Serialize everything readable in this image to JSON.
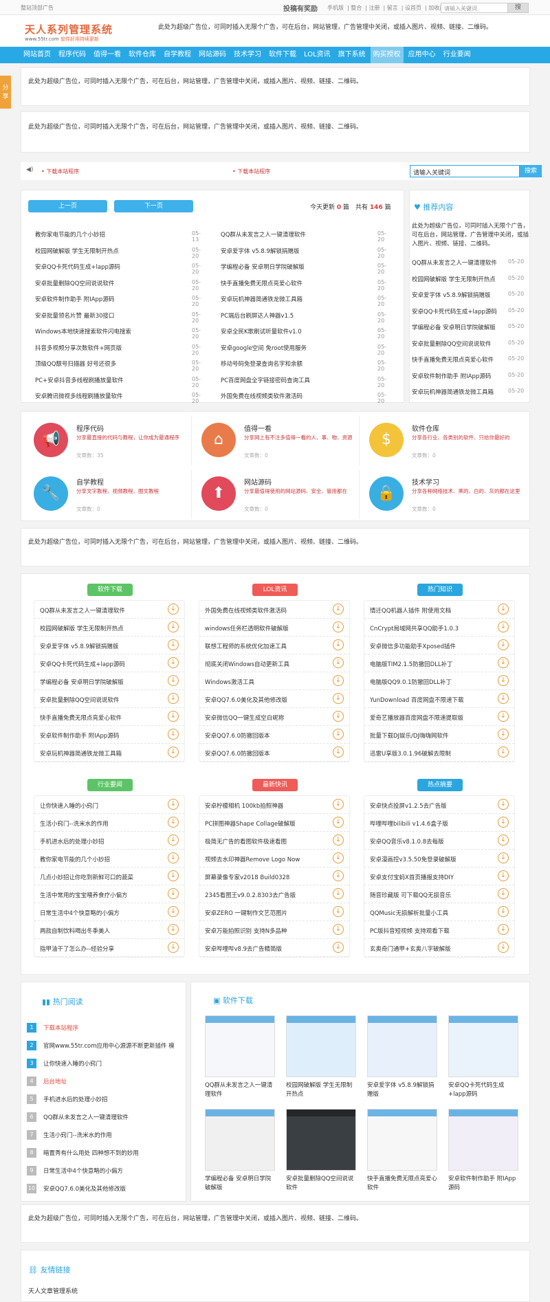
{
  "topbar": {
    "left": "整站顶部广告",
    "contribute": "投稿有奖励",
    "links": [
      "手机版",
      "整合",
      "注册",
      "留言",
      "设首页",
      "加收藏"
    ],
    "search_placeholder": "请输入关键词",
    "search_btn": "搜"
  },
  "header": {
    "logo_title": "天人系列管理系统",
    "logo_url": "www.55tr.com",
    "logo_slogan": "软件好用持续更新",
    "ad": "此处为超级广告位，可同时插入无限个广告，可在后台，网站管理，广告管理中关闭，或插入图片、视频、链接、二维码。"
  },
  "nav": [
    "网站首页",
    "程序代码",
    "值得一看",
    "软件仓库",
    "自学教程",
    "网站源码",
    "技术学习",
    "软件下载",
    "LOL资讯",
    "旗下系统",
    "购买授权",
    "应用中心",
    "行业要闻"
  ],
  "side_tab": "分享",
  "ads": {
    "ad1": "此处为超级广告位，可同时插入无限个广告，可在后台，网站管理，广告管理中关闭，或插入图片、视频、链接、二维码。",
    "ad2": "此处为超级广告位，可同时插入无限个广告，可在后台，网站管理，广告管理中关闭，或插入图片、视频、链接、二维码。",
    "ad3": "此处为超级广告位，可同时插入无限个广告，可在后台，网站管理，广告管理中关闭，或插入图片、视频、链接、二维码。",
    "ad4": "此处为超级广告位，可同时插入无限个广告，可在后台，网站管理，广告管理中关闭，或插入图片、视频、链接、二维码。"
  },
  "notice": {
    "n1": "下载本站程序",
    "n2": "下载本站程序",
    "search_value": "请输入关键词",
    "search_btn": "搜索"
  },
  "latest": {
    "prev": "上一页",
    "next": "下一页",
    "update_prefix": "今天更新",
    "update_count": "0",
    "update_mid": "篇　共有",
    "total_count": "146",
    "update_suffix": "篇",
    "left": [
      {
        "t": "教你家电节能的几个小妙招",
        "d": "05-13"
      },
      {
        "t": "校园网破解版 学生无限制开热点",
        "d": "05-20"
      },
      {
        "t": "安卓QQ卡死代码生成+lapp源码",
        "d": "05-20"
      },
      {
        "t": "安卓批量删除QQ空间说说软件",
        "d": "05-20"
      },
      {
        "t": "安卓软件制作助手 附IApp源码",
        "d": "05-20"
      },
      {
        "t": "安卓批量领名片赞 最新30接口",
        "d": "05-20"
      },
      {
        "t": "Windows本地快速搜索软件闪电搜索",
        "d": "05-20"
      },
      {
        "t": "抖音多视频分享次数软件+网页版",
        "d": "05-20"
      },
      {
        "t": "顶级QQ靓号扫描器 好号还很多",
        "d": "05-20"
      },
      {
        "t": "PC+安卓抖音多线程刷播放量软件",
        "d": "05-20"
      },
      {
        "t": "安卓腾讯微视多线程刷播放量软件",
        "d": "05-20"
      }
    ],
    "right": [
      {
        "t": "QQ群从未发言之人一键清理软件",
        "d": "05-20"
      },
      {
        "t": "安卓爱字体 v5.8.9解锁捐赠版",
        "d": "05-20"
      },
      {
        "t": "学编程必备 安卓明日学院破解版",
        "d": "05-20"
      },
      {
        "t": "快手直播免费无限点亮爱心软件",
        "d": "05-20"
      },
      {
        "t": "安卓玩机神器简通铁龙微工具箱",
        "d": "05-20"
      },
      {
        "t": "PC端后台刷屏达人神器v1.5",
        "d": "05-20"
      },
      {
        "t": "安卓全民K歌刷试听量软件v1.0",
        "d": "05-20"
      },
      {
        "t": "安卓google空间 免root使用服务",
        "d": "05-20"
      },
      {
        "t": "移动号码免登录查询名字和余额",
        "d": "05-20"
      },
      {
        "t": "PC百度网盘全字链接密码查询工具",
        "d": "05-20"
      },
      {
        "t": "外国免费在线视频类软件激活码",
        "d": "05-20"
      }
    ]
  },
  "recommend": {
    "title": "推荐内容",
    "intro": "此处为超级广告位，可同时插入无限个广告，可在后台，网站管理，广告管理中关闭，或插入图片、视频、链接、二维码。",
    "items": [
      {
        "t": "QQ群从未发言之人一键清理软件",
        "d": "05-20"
      },
      {
        "t": "校园网破解版 学生无限制开热点",
        "d": "05-20"
      },
      {
        "t": "安卓爱字体 v5.8.9解锁捐赠版",
        "d": "05-20"
      },
      {
        "t": "安卓QQ卡死代码生成+lapp源码",
        "d": "05-20"
      },
      {
        "t": "学编程必备 安卓明日学院破解版",
        "d": "05-20"
      },
      {
        "t": "安卓批量删除QQ空间说说软件",
        "d": "05-20"
      },
      {
        "t": "快手直播免费无限点亮爱心软件",
        "d": "05-20"
      },
      {
        "t": "安卓软件制作助手 附IApp源码",
        "d": "05-20"
      },
      {
        "t": "安卓玩机神器简通铁龙微工具箱",
        "d": "05-20"
      }
    ]
  },
  "categories": [
    {
      "name": "程序代码",
      "desc": "分享最直接的代码与教程，让你成为最通程序",
      "count": "文章数：35",
      "color": "#e04a5a",
      "icon": "megaphone-icon"
    },
    {
      "name": "值得一看",
      "desc": "分享网上有不注多值得一看的人、事、物、资源",
      "count": "文章数：0",
      "color": "#e97b4a",
      "icon": "house-icon"
    },
    {
      "name": "软件仓库",
      "desc": "分享各行业、各类别的软件、只给你最好的",
      "count": "文章数：0",
      "color": "#f3c33a",
      "icon": "coin-icon"
    },
    {
      "name": "自学教程",
      "desc": "分享文字教程、视频教程、图文教程",
      "count": "文章数：0",
      "color": "#39aee3",
      "icon": "wrench-icon"
    },
    {
      "name": "网站源码",
      "desc": "分享最值得使用的网站源码、安全、管用都在",
      "count": "文章数：0",
      "color": "#e04a5a",
      "icon": "cloud-upload-icon"
    },
    {
      "name": "技术学习",
      "desc": "分享各种网络技术、黑的、白的、灰的都在这里",
      "count": "文章数：0",
      "color": "#39aee3",
      "icon": "lock-icon"
    }
  ],
  "sections": [
    {
      "title": "软件下载",
      "color": "#5cc466",
      "items": [
        "QQ群从未发言之人一键清理软件",
        "校园网破解版 学生无限制开热点",
        "安卓爱字体 v5.8.9解锁捐赠版",
        "安卓QQ卡死代码生成+lapp源码",
        "学编程必备 安卓明日学院破解版",
        "安卓批量删除QQ空间说说软件",
        "快手直播免费无限点亮爱心软件",
        "安卓软件制作助手 附IApp源码",
        "安卓玩机神器简通铁龙微工具箱"
      ]
    },
    {
      "title": "LOL资讯",
      "color": "#ef5b56",
      "items": [
        "外国免费在线视频类软件激活码",
        "windows任务栏透明软件破解版",
        "联想工程师的系统优化加速工具",
        "彻底关闭Windows自动更新工具",
        "Windows激活工具",
        "安卓QQ7.6.0美化及其他修改版",
        "安卓微信QQ一键生成空白昵称",
        "安卓QQ7.6.0防撤回版本",
        "安卓QQ7.6.0防撤回版本"
      ]
    },
    {
      "title": "热门知识",
      "color": "#2aa5de",
      "items": [
        "情迁QQ机器人插件 附使用文档",
        "CnCrypt局域网共享QQ助手1.0.3",
        "安卓微信多功能助手Xposed插件",
        "电脑版TIM2.1.5防撤回DLL补丁",
        "电脑版QQ9.0.1防撤回DLL补丁",
        "YunDownload 百度网盘不限速下载",
        "爱奇艺播放器百度网盘不限速提取版",
        "批量下载DJ娱乐/DJ嗨嗨网软件",
        "迅雷U享版3.0.1.96破解去限制"
      ]
    },
    {
      "title": "行业要闻",
      "color": "#5cc466",
      "items": [
        "让你快速入睡的小窍门",
        "生活小窍门--洗米水的作用",
        "手机进水后的处理小妙招",
        "教你家电节能的几个小妙招",
        "几点小妙招让你吃到新鲜可口的蔬菜",
        "生活中常用的宝宝喂养食疗小偏方",
        "日常生活中4个快意略的小偏方",
        "两款自制饮料喝出冬季美人",
        "指甲油干了怎么办--经验分享"
      ]
    },
    {
      "title": "最新快讯",
      "color": "#ef5b56",
      "items": [
        "安卓柠檬相机 100kb拍照神器",
        "PC拼图神器Shape Collage破解版",
        "极简无广告的看图软件极速看图",
        "视频去水印神器Remove Logo Now",
        "屏幕录像专家v2018 Build0328",
        "2345看图王v9.0.2.8303去广告版",
        "安卓ZERO 一键制作文艺范图片",
        "安卓万能拍照识别 支持N多品种",
        "安卓哔哩哔v8.9去广告精简版"
      ]
    },
    {
      "title": "热点摘要",
      "color": "#2aa5de",
      "items": [
        "安卓快点投屏v1.2.5去广告版",
        "哔哩哔哩bilibili v1.4.6盒子版",
        "安卓QQ音乐v8.1.0.8去每版",
        "安卓漫画控v3.5.50免登录破解版",
        "安卓支付宝蚂X首页播报支持DIY",
        "随音珍藏版 可下载QQ无损音乐",
        "QQMusic无损解析批量小工具",
        "PC版抖音短视频 支持观看下载",
        "玄奥奇门通甲+玄奥八字破解版"
      ]
    }
  ],
  "hot_read": {
    "title": "热门阅读",
    "items": [
      "下载本站程序",
      "官网www.55tr.com应用中心源源不断更新插件 模",
      "让你快速入睡的小窍门",
      "后台地址",
      "手机进水后的处理小妙招",
      "QQ群从未发言之人一键清理软件",
      "生活小窍门--洗米水的作用",
      "暗置秀有什么用处 四种想不到的妙用",
      "日常生活中4个快意略的小偏方",
      "安卓QQ7.6.0美化及其他修改版"
    ],
    "highlight_color": "#2aa5de",
    "red_color": "#e04a3a"
  },
  "soft_dl": {
    "title": "软件下载",
    "items": [
      "QQ群从未发言之人一键清理软件",
      "校园网破解版 学生无限制开热点",
      "安卓爱字体 v5.8.9解锁捐赠版",
      "安卓QQ卡死代码生成+lapp源码",
      "学编程必备 安卓明日学院破解版",
      "安卓批量删除QQ空间说说软件",
      "快手直播免费无限点亮爱心软件",
      "安卓软件制作助手 附IApp源码"
    ]
  },
  "links": {
    "title": "友情链接",
    "items": [
      "天人文章管理系统"
    ]
  }
}
